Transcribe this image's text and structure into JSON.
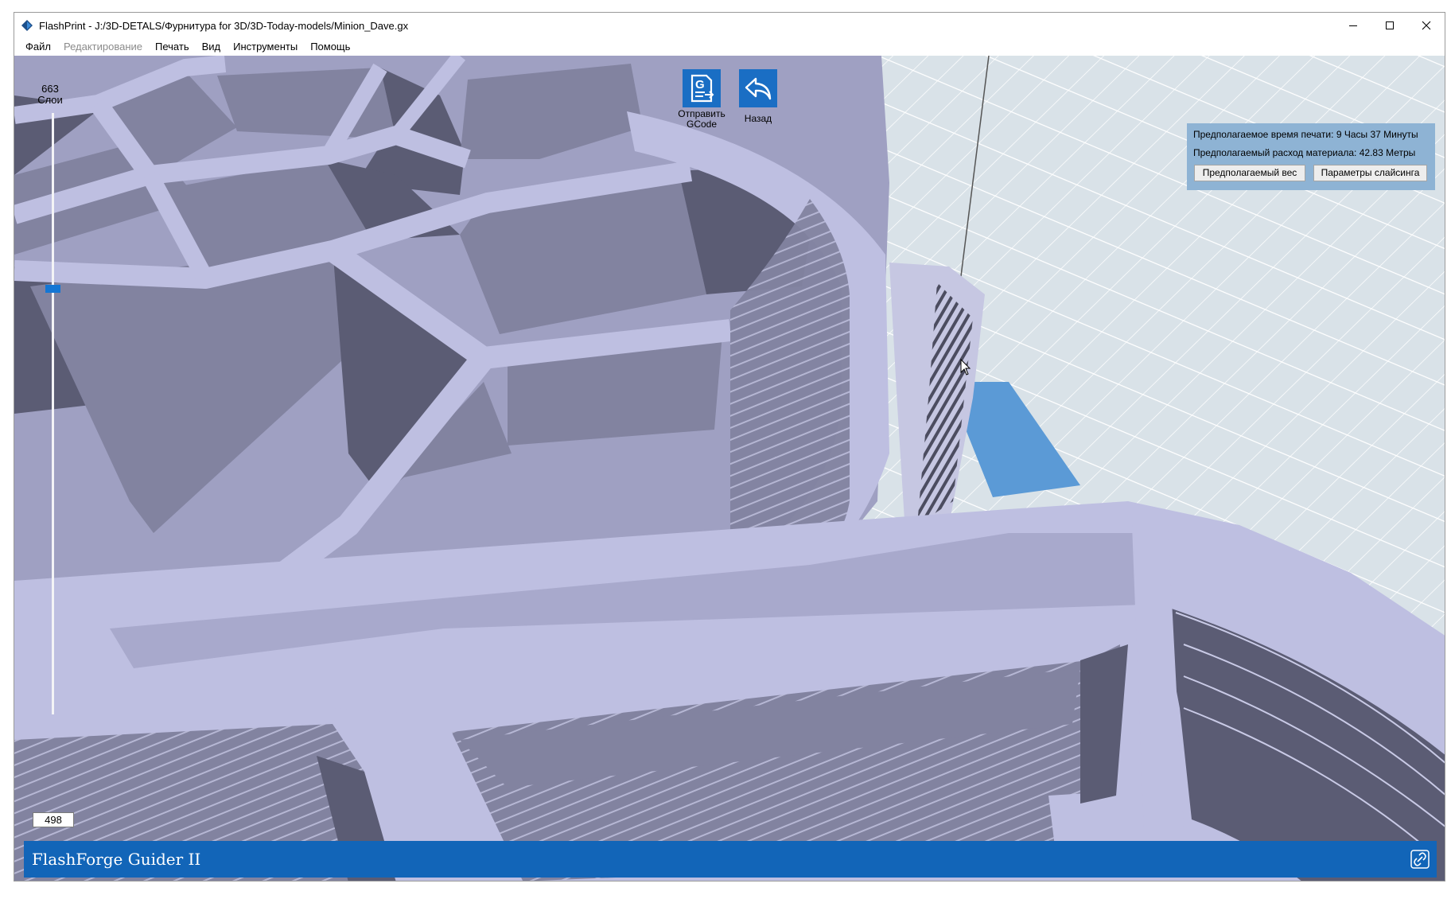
{
  "window": {
    "title": "FlashPrint - J:/3D-DETALS/Фурнитура for 3D/3D-Today-models/Minion_Dave.gx"
  },
  "menu": [
    "Файл",
    "Редактирование",
    "Печать",
    "Вид",
    "Инструменты",
    "Помощь"
  ],
  "layer_slider": {
    "top_value": "663",
    "top_label": "Слои",
    "bottom_value": "498"
  },
  "toolbar": {
    "send_gcode_label_line1": "Отправить",
    "send_gcode_label_line2": "GCode",
    "back_label": "Назад"
  },
  "estimates": {
    "time_label": "Предполагаемое время печати:",
    "time_value": "9 Часы 37 Минуты",
    "material_label": "Предполагаемый расход материала:",
    "material_value": "42.83 Метры",
    "weight_button": "Предполагаемый вес",
    "slicing_params_button": "Параметры слайсинга"
  },
  "status": {
    "printer_name": "FlashForge Guider II"
  },
  "colors": {
    "accent": "#1265b8",
    "model_light": "#b9badb",
    "model_mid": "#8283a0",
    "model_dark": "#5b5c74",
    "bed": "#d8e3ea",
    "grid": "#ffffff",
    "support_highlight": "#5b9ad6",
    "info_panel": "#8eb3d4"
  },
  "icons": [
    "app-logo-icon",
    "minimize-icon",
    "maximize-icon",
    "close-icon",
    "send-gcode-icon",
    "back-arrow-icon",
    "link-icon",
    "mouse-cursor-icon"
  ]
}
